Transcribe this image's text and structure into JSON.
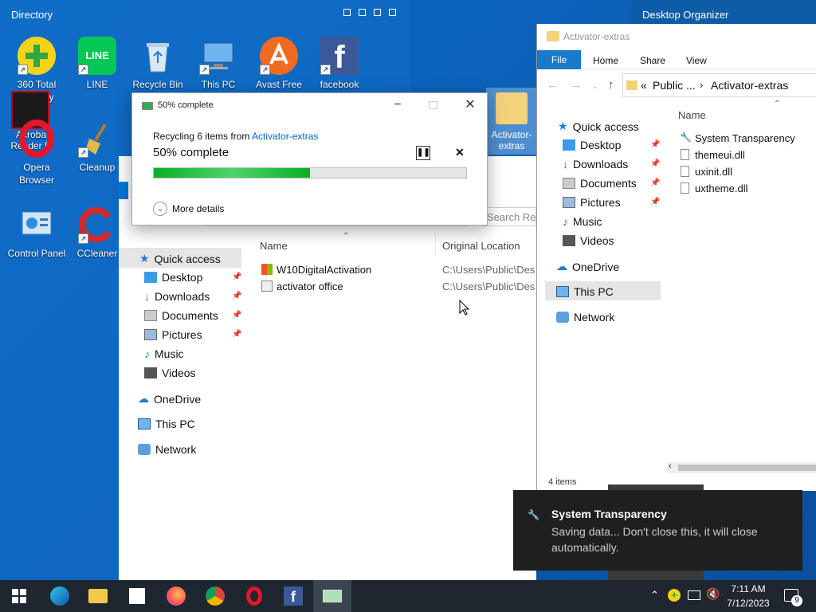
{
  "fences": {
    "left_title": "Directory",
    "right_title": "Desktop Organizer"
  },
  "desktop_icons": [
    {
      "label": "360 Total Security"
    },
    {
      "label": "LINE"
    },
    {
      "label": "Recycle Bin"
    },
    {
      "label": "This PC"
    },
    {
      "label": "Avast Free"
    },
    {
      "label": "facebook"
    },
    {
      "label": "Opera Browser"
    },
    {
      "label": "Cleanup"
    },
    {
      "label": "Control Panel"
    },
    {
      "label": "CCleaner"
    },
    {
      "label": "Activator-extras"
    },
    {
      "label": "Acroba Reader D"
    }
  ],
  "dialog": {
    "title": "50% complete",
    "recycling_prefix": "Recycling 6 items from ",
    "source_link": "Activator-extras",
    "status": "50% complete",
    "progress_percent": 50,
    "more_details": "More details"
  },
  "recycle_window": {
    "search_placeholder": "Search Re",
    "columns": {
      "name": "Name",
      "original_location": "Original Location"
    },
    "files": [
      {
        "name": "W10DigitalActivation",
        "location": "C:\\Users\\Public\\Des"
      },
      {
        "name": "activator office",
        "location": "C:\\Users\\Public\\Des"
      }
    ],
    "nav": {
      "quick_access": "Quick access",
      "desktop": "Desktop",
      "downloads": "Downloads",
      "documents": "Documents",
      "pictures": "Pictures",
      "music": "Music",
      "videos": "Videos",
      "onedrive": "OneDrive",
      "this_pc": "This PC",
      "network": "Network"
    }
  },
  "explorer": {
    "title": "Activator-extras",
    "ribbon": {
      "file": "File",
      "home": "Home",
      "share": "Share",
      "view": "View"
    },
    "breadcrumb": {
      "overflow": "«",
      "parent": "Public ...",
      "current": "Activator-extras"
    },
    "column_name": "Name",
    "files": [
      {
        "name": "System Transparency"
      },
      {
        "name": "themeui.dll"
      },
      {
        "name": "uxinit.dll"
      },
      {
        "name": "uxtheme.dll"
      }
    ],
    "nav": {
      "quick_access": "Quick access",
      "desktop": "Desktop",
      "downloads": "Downloads",
      "documents": "Documents",
      "pictures": "Pictures",
      "music": "Music",
      "videos": "Videos",
      "onedrive": "OneDrive",
      "this_pc": "This PC",
      "network": "Network"
    },
    "status": "4 items"
  },
  "toast": {
    "title": "System Transparency",
    "message": "Saving data... Don't close this, it will close automatically."
  },
  "taskbar": {
    "time": "7:11 AM",
    "date": "7/12/2023",
    "notification_count": "9"
  },
  "colors": {
    "accent": "#0078d7",
    "progress": "#06b025",
    "link": "#0066cc",
    "taskbar": "#1e2630"
  }
}
